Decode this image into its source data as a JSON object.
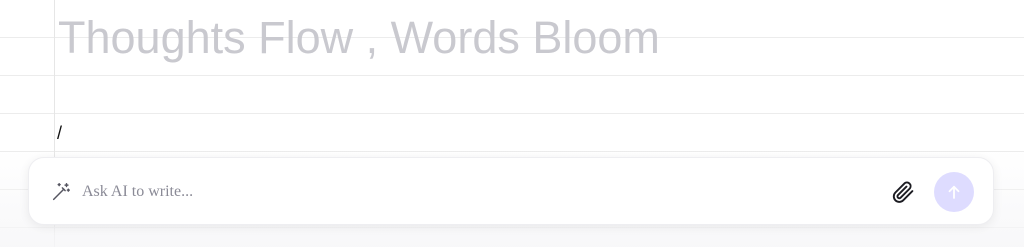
{
  "document": {
    "title_placeholder": "Thoughts Flow , Words Bloom",
    "slash_text": "/"
  },
  "ai_bar": {
    "placeholder": "Ask AI to write...",
    "left_icon": "magic-wand-icon",
    "attach_icon": "paperclip-icon",
    "send_icon": "arrow-up-icon"
  },
  "colors": {
    "title_placeholder": "#c9c9cf",
    "send_button_bg": "#dedcff",
    "ruled_line": "#ececec"
  }
}
